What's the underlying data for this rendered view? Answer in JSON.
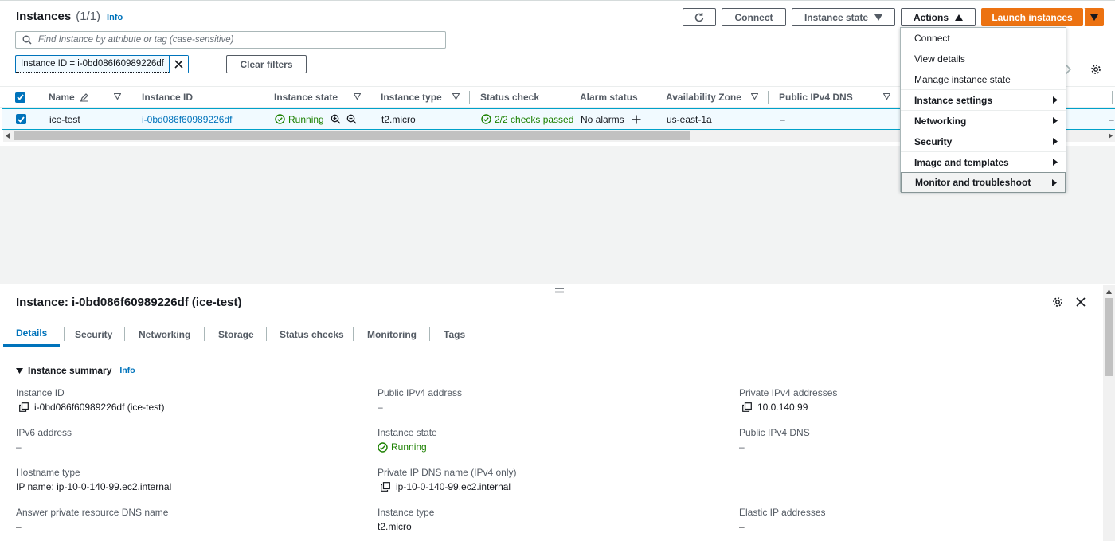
{
  "header": {
    "title": "Instances",
    "count": "(1/1)",
    "info": "Info",
    "buttons": {
      "connect": "Connect",
      "instance_state": "Instance state",
      "actions": "Actions",
      "launch": "Launch instances"
    }
  },
  "search": {
    "placeholder": "Find Instance by attribute or tag (case-sensitive)"
  },
  "filter": {
    "token": "Instance ID = i-0bd086f60989226df",
    "clear": "Clear filters"
  },
  "table": {
    "columns": [
      "Name",
      "Instance ID",
      "Instance state",
      "Instance type",
      "Status check",
      "Alarm status",
      "Availability Zone",
      "Public IPv4 DNS"
    ],
    "row": {
      "name": "ice-test",
      "instance_id": "i-0bd086f60989226df",
      "state": "Running",
      "type": "t2.micro",
      "status_check": "2/2 checks passed",
      "alarm": "No alarms",
      "az": "us-east-1a",
      "dns": "–",
      "extra": "–"
    }
  },
  "actions_menu": {
    "items": [
      {
        "label": "Connect"
      },
      {
        "label": "View details"
      },
      {
        "label": "Manage instance state"
      },
      {
        "label": "Instance settings"
      },
      {
        "label": "Networking"
      },
      {
        "label": "Security"
      },
      {
        "label": "Image and templates"
      },
      {
        "label": "Monitor and troubleshoot"
      }
    ]
  },
  "detail": {
    "title": "Instance: i-0bd086f60989226df (ice-test)",
    "tabs": [
      "Details",
      "Security",
      "Networking",
      "Storage",
      "Status checks",
      "Monitoring",
      "Tags"
    ],
    "summary_title": "Instance summary",
    "summary_info": "Info",
    "fields": {
      "instance_id": {
        "label": "Instance ID",
        "value": "i-0bd086f60989226df (ice-test)"
      },
      "public_ipv4": {
        "label": "Public IPv4 address",
        "value": "–"
      },
      "private_ipv4": {
        "label": "Private IPv4 addresses",
        "value": "10.0.140.99"
      },
      "ipv6": {
        "label": "IPv6 address",
        "value": "–"
      },
      "state": {
        "label": "Instance state",
        "value": "Running"
      },
      "public_dns": {
        "label": "Public IPv4 DNS",
        "value": "–"
      },
      "hostname_type": {
        "label": "Hostname type",
        "value": "IP name: ip-10-0-140-99.ec2.internal"
      },
      "private_dns": {
        "label": "Private IP DNS name (IPv4 only)",
        "value": "ip-10-0-140-99.ec2.internal"
      },
      "answer_dns": {
        "label": "Answer private resource DNS name",
        "value": "–"
      },
      "instance_type": {
        "label": "Instance type",
        "value": "t2.micro"
      },
      "elastic_ip": {
        "label": "Elastic IP addresses",
        "value": "–"
      }
    }
  },
  "colors": {
    "accent": "#0073bb",
    "primary": "#ec7211",
    "success": "#1d8102"
  }
}
